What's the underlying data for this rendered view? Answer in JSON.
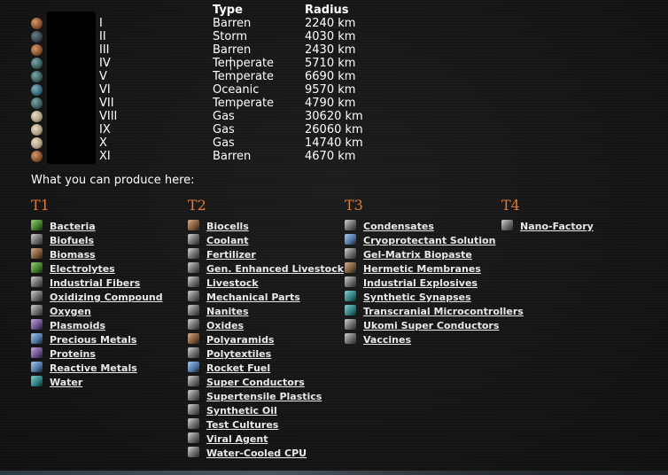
{
  "planet_table": {
    "type_header": "Type",
    "radius_header": "Radius",
    "rows": [
      {
        "num": "I",
        "type": "Barren",
        "radius": "2240 km",
        "icon": "barren-planet-icon"
      },
      {
        "num": "II",
        "type": "Storm",
        "radius": "4030 km",
        "icon": "storm-planet-icon"
      },
      {
        "num": "III",
        "type": "Barren",
        "radius": "2430 km",
        "icon": "barren-planet-icon"
      },
      {
        "num": "IV",
        "type": "Temperate",
        "radius": "5710 km",
        "icon": "temperate-planet-icon"
      },
      {
        "num": "V",
        "type": "Temperate",
        "radius": "6690 km",
        "icon": "temperate-planet-icon"
      },
      {
        "num": "VI",
        "type": "Oceanic",
        "radius": "9570 km",
        "icon": "oceanic-planet-icon"
      },
      {
        "num": "VII",
        "type": "Temperate",
        "radius": "4790 km",
        "icon": "temperate-planet-icon"
      },
      {
        "num": "VIII",
        "type": "Gas",
        "radius": "30620 km",
        "icon": "gas-planet-icon"
      },
      {
        "num": "IX",
        "type": "Gas",
        "radius": "26060 km",
        "icon": "gas-planet-icon"
      },
      {
        "num": "X",
        "type": "Gas",
        "radius": "14740 km",
        "icon": "gas-planet-icon"
      },
      {
        "num": "XI",
        "type": "Barren",
        "radius": "4670 km",
        "icon": "barren-planet-icon"
      }
    ]
  },
  "produce_heading": "What you can produce here:",
  "tiers": [
    {
      "label": "T1",
      "items": [
        "Bacteria",
        "Biofuels",
        "Biomass",
        "Electrolytes",
        "Industrial Fibers",
        "Oxidizing Compound",
        "Oxygen",
        "Plasmoids",
        "Precious Metals",
        "Proteins",
        "Reactive Metals",
        "Water"
      ]
    },
    {
      "label": "T2",
      "items": [
        "Biocells",
        "Coolant",
        "Fertilizer",
        "Gen. Enhanced Livestock",
        "Livestock",
        "Mechanical Parts",
        "Nanites",
        "Oxides",
        "Polyaramids",
        "Polytextiles",
        "Rocket Fuel",
        "Super Conductors",
        "Supertensile Plastics",
        "Synthetic Oil",
        "Test Cultures",
        "Viral Agent",
        "Water-Cooled CPU"
      ]
    },
    {
      "label": "T3",
      "items": [
        "Condensates",
        "Cryoprotectant Solution",
        "Gel-Matrix Biopaste",
        "Hermetic Membranes",
        "Industrial Explosives",
        "Synthetic Synapses",
        "Transcranial Microcontrollers",
        "Ukomi Super Conductors",
        "Vaccines"
      ]
    },
    {
      "label": "T4",
      "items": [
        "Nano-Factory"
      ]
    }
  ],
  "colors": {
    "background": "#131313",
    "tier_label": "#e07a3a",
    "link": "#e9e9e9"
  }
}
